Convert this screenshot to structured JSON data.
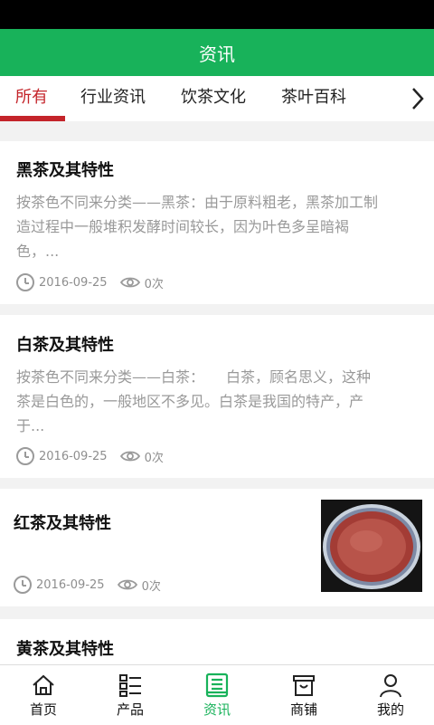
{
  "header": {
    "title": "资讯"
  },
  "tabs": [
    {
      "label": "所有",
      "active": true
    },
    {
      "label": "行业资讯",
      "active": false
    },
    {
      "label": "饮茶文化",
      "active": false
    },
    {
      "label": "茶叶百科",
      "active": false
    }
  ],
  "articles": [
    {
      "title": "黑茶及其特性",
      "summary_lines": [
        "按茶色不同来分类——黑茶：由于原料粗老，黑茶加工制",
        "造过程中一般堆积发酵时间较长，因为叶色多呈暗褐",
        "色，..."
      ],
      "date": "2016-09-25",
      "views": "0次"
    },
    {
      "title": "白茶及其特性",
      "summary_lines": [
        "按茶色不同来分类——白茶：　　白茶，顾名思义，这种",
        "茶是白色的，一般地区不多见。白茶是我国的特产，产",
        "于..."
      ],
      "date": "2016-09-25",
      "views": "0次"
    },
    {
      "title": "红茶及其特性",
      "date": "2016-09-25",
      "views": "0次",
      "has_thumbnail": true
    },
    {
      "title": "黄茶及其特性"
    }
  ],
  "bottom_nav": [
    {
      "label": "首页",
      "icon": "home-icon",
      "active": false
    },
    {
      "label": "产品",
      "icon": "list-icon",
      "active": false
    },
    {
      "label": "资讯",
      "icon": "news-icon",
      "active": true
    },
    {
      "label": "商铺",
      "icon": "shop-icon",
      "active": false
    },
    {
      "label": "我的",
      "icon": "user-icon",
      "active": false
    }
  ],
  "colors": {
    "brand_green": "#18b25a",
    "tab_active_red": "#c4242a"
  }
}
